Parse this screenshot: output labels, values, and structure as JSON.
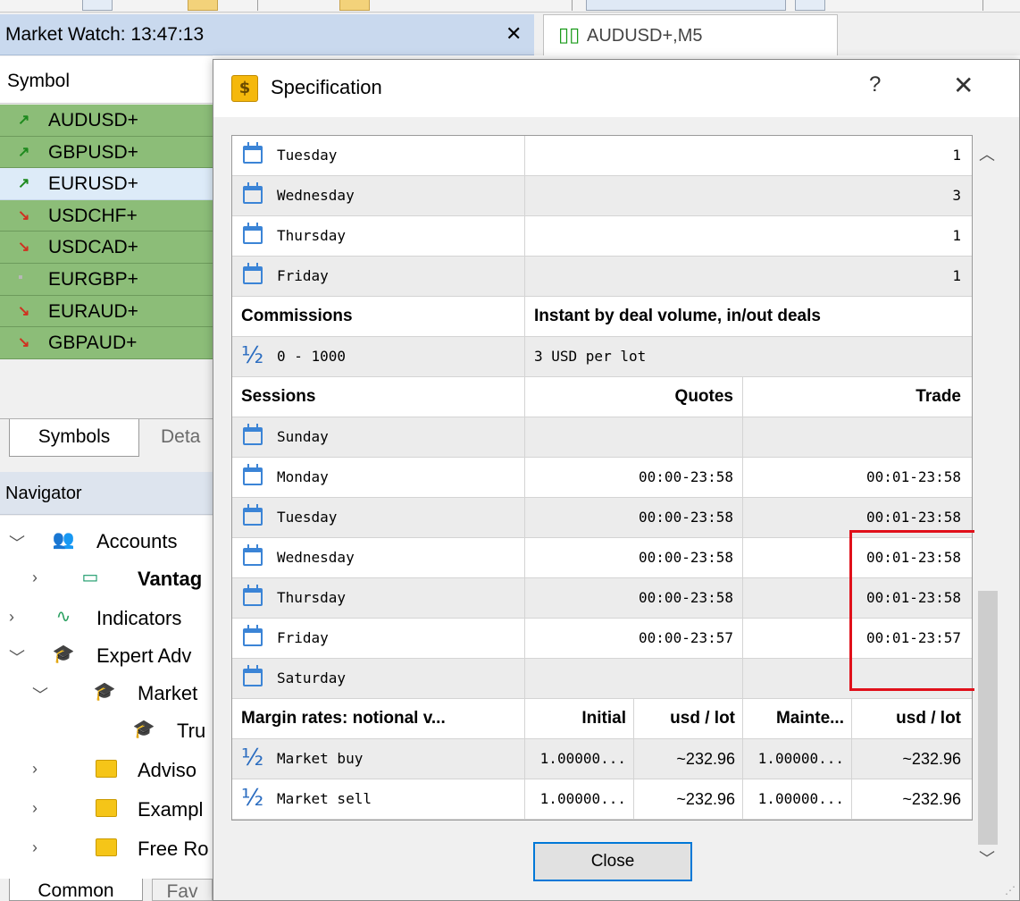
{
  "market_watch": {
    "title": "Market Watch: 13:47:13",
    "close_glyph": "✕",
    "column_symbol": "Symbol",
    "symbols": [
      {
        "name": "AUDUSD+",
        "direction": "up",
        "selected": false
      },
      {
        "name": "GBPUSD+",
        "direction": "up",
        "selected": false
      },
      {
        "name": "EURUSD+",
        "direction": "up",
        "selected": true
      },
      {
        "name": "USDCHF+",
        "direction": "down",
        "selected": false
      },
      {
        "name": "USDCAD+",
        "direction": "down",
        "selected": false
      },
      {
        "name": "EURGBP+",
        "direction": "flat",
        "selected": false
      },
      {
        "name": "EURAUD+",
        "direction": "down",
        "selected": false
      },
      {
        "name": "GBPAUD+",
        "direction": "down",
        "selected": false
      }
    ],
    "tabs": {
      "symbols": "Symbols",
      "details": "Deta"
    }
  },
  "navigator": {
    "title": "Navigator",
    "items": {
      "accounts": "Accounts",
      "vantage": "Vantag",
      "indicators": "Indicators",
      "expert_advisors": "Expert Adv",
      "market": "Market",
      "trust": "Tru",
      "advisors": "Adviso",
      "examples": "Exampl",
      "free_robots": "Free Ro"
    },
    "tabs": {
      "common": "Common",
      "favorites": "Fav"
    }
  },
  "chart_tab": {
    "title": "AUDUSD+,M5"
  },
  "dialog": {
    "title": "Specification",
    "help": "?",
    "close_glyph": "✕",
    "close_button": "Close",
    "swap_days": [
      {
        "day": "Tuesday",
        "value": "1"
      },
      {
        "day": "Wednesday",
        "value": "3"
      },
      {
        "day": "Thursday",
        "value": "1"
      },
      {
        "day": "Friday",
        "value": "1"
      }
    ],
    "commissions": {
      "label": "Commissions",
      "type": "Instant by deal volume, in/out deals",
      "range": "0 - 1000",
      "rate": "3 USD per lot"
    },
    "sessions": {
      "label": "Sessions",
      "col_quotes": "Quotes",
      "col_trade": "Trade",
      "days": [
        {
          "day": "Sunday",
          "quotes": "",
          "trade": ""
        },
        {
          "day": "Monday",
          "quotes": "00:00-23:58",
          "trade": "00:01-23:58"
        },
        {
          "day": "Tuesday",
          "quotes": "00:00-23:58",
          "trade": "00:01-23:58"
        },
        {
          "day": "Wednesday",
          "quotes": "00:00-23:58",
          "trade": "00:01-23:58"
        },
        {
          "day": "Thursday",
          "quotes": "00:00-23:58",
          "trade": "00:01-23:58"
        },
        {
          "day": "Friday",
          "quotes": "00:00-23:57",
          "trade": "00:01-23:57"
        },
        {
          "day": "Saturday",
          "quotes": "",
          "trade": ""
        }
      ]
    },
    "margin": {
      "label": "Margin rates: notional v...",
      "col_initial": "Initial",
      "col_usd1": "usd / lot",
      "col_maint": "Mainte...",
      "col_usd2": "usd / lot",
      "rows": [
        {
          "label": "Market buy",
          "initial": "1.00000...",
          "usd1": "~232.96",
          "maint": "1.00000...",
          "usd2": "~232.96"
        },
        {
          "label": "Market sell",
          "initial": "1.00000...",
          "usd1": "~232.96",
          "maint": "1.00000...",
          "usd2": "~232.96"
        }
      ]
    }
  },
  "colors": {
    "symbol_bg": "#8cbd78",
    "up_arrow": "#1e8a1e",
    "down_arrow": "#d03020",
    "highlight": "#e0101a",
    "accent": "#0078d7"
  }
}
